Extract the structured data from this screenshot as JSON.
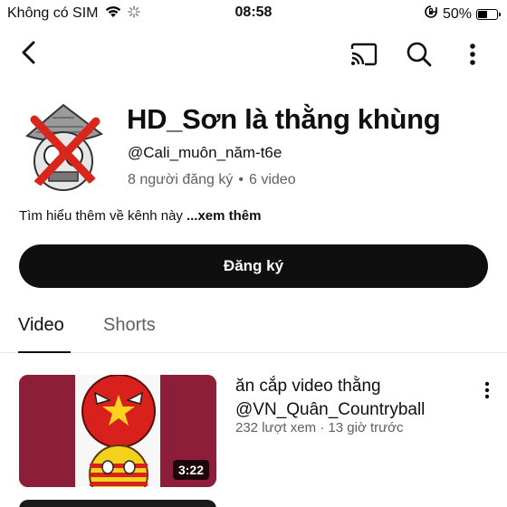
{
  "status": {
    "carrier": "Không có SIM",
    "time": "08:58",
    "battery_text": "50%",
    "battery_level": 0.5
  },
  "topbar": {
    "back_icon": "chevron-left-icon",
    "cast_icon": "cast-icon",
    "search_icon": "search-icon",
    "more_icon": "more-vertical-icon"
  },
  "channel": {
    "name": "HD_Sơn là thằng khùng",
    "handle": "@Cali_muôn_năm-t6e",
    "subscribers": "8 người đăng ký",
    "separator": "•",
    "video_count": "6 video",
    "about": "Tìm hiểu thêm về kênh này",
    "about_more": "...xem thêm",
    "subscribe_label": "Đăng ký"
  },
  "tabs": [
    {
      "label": "Video",
      "active": true
    },
    {
      "label": "Shorts",
      "active": false
    }
  ],
  "videos": [
    {
      "title": "ăn cắp video thằng @VN_Quân_Countryball",
      "views": "232 lượt xem",
      "separator": "·",
      "age": "13 giờ trước",
      "duration": "3:22"
    }
  ],
  "colors": {
    "primary_text": "#0f0f0f",
    "secondary_text": "#606060",
    "subscribe_bg": "#0f0f0f",
    "thumb_bg": "#8c1e3a"
  }
}
